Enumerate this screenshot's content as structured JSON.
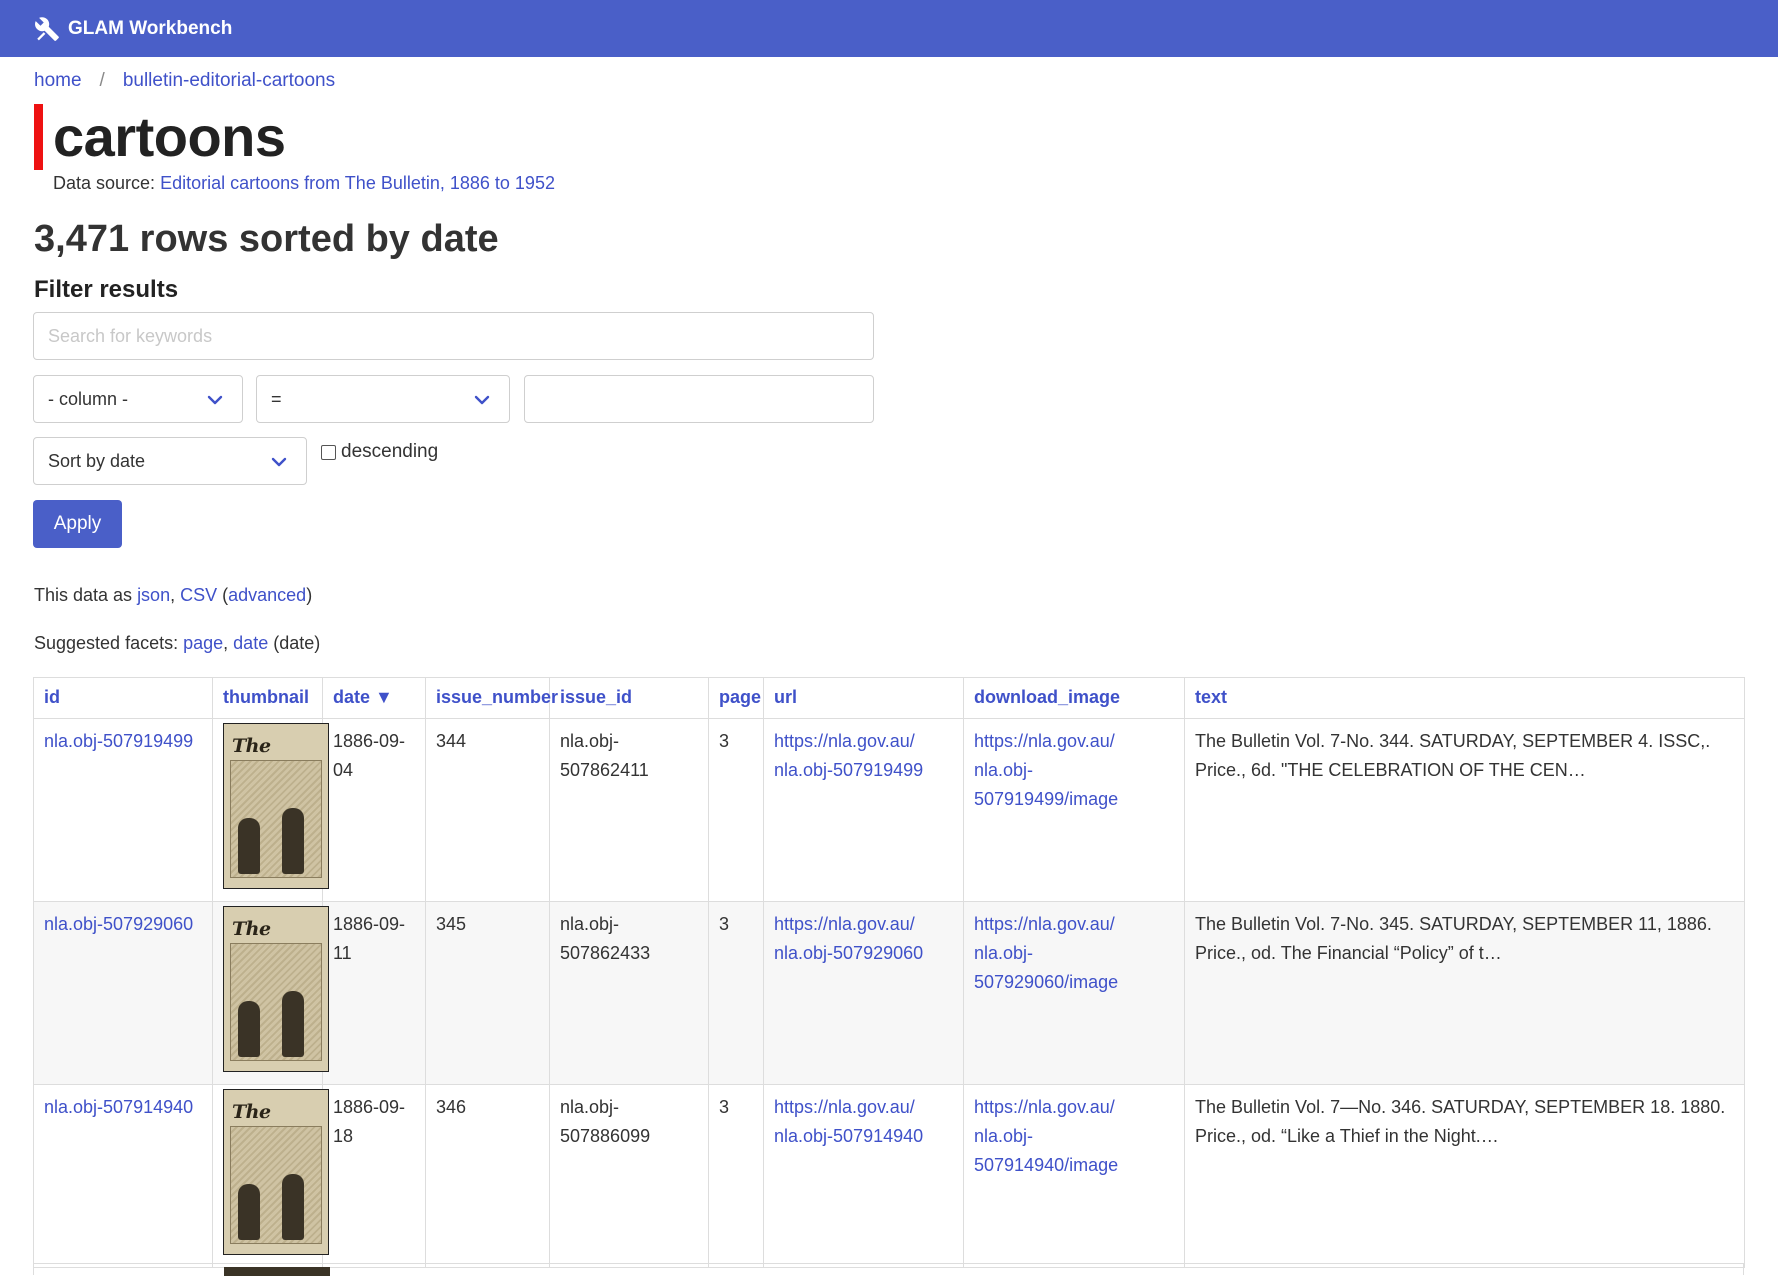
{
  "header": {
    "brand": "GLAM Workbench",
    "logo_icon": "tools-icon"
  },
  "breadcrumb": {
    "home": "home",
    "sep": "/",
    "database": "bulletin-editorial-cartoons"
  },
  "page": {
    "title": "cartoons",
    "source_prefix": "Data source: ",
    "source_link": "Editorial cartoons from The Bulletin, 1886 to 1952",
    "row_count": "3,471 rows sorted by date"
  },
  "filter": {
    "heading": "Filter results",
    "search_placeholder": "Search for keywords",
    "column_selected": "- column -",
    "operator_selected": "=",
    "sort_selected": "Sort by date",
    "descending_label": "descending",
    "apply_label": "Apply"
  },
  "export": {
    "prefix": "This data as ",
    "json": "json",
    "comma": ", ",
    "csv": "CSV",
    "open": " (",
    "advanced": "advanced",
    "close": ")"
  },
  "facets": {
    "prefix": "Suggested facets: ",
    "page": "page",
    "comma": ", ",
    "date": "date",
    "suffix": " (date)"
  },
  "table": {
    "columns": [
      "id",
      "thumbnail",
      "date ▼",
      "issue_number",
      "issue_id",
      "page",
      "url",
      "download_image",
      "text"
    ],
    "rows": [
      {
        "id": "nla.obj-507919499",
        "date": "1886-09-04",
        "issue_number": "344",
        "issue_id": "nla.obj-507862411",
        "page": "3",
        "url_1": "https://nla.gov.au/",
        "url_2": "nla.obj-507919499",
        "dl_1": "https://nla.gov.au/",
        "dl_2": "nla.obj-507919499/image",
        "text": "The Bulletin Vol. 7-No. 344. SATURDAY, SEPTEMBER 4. ISSC,. Price., 6d. \"THE CELEBRATION OF THE CEN…"
      },
      {
        "id": "nla.obj-507929060",
        "date": "1886-09-11",
        "issue_number": "345",
        "issue_id": "nla.obj-507862433",
        "page": "3",
        "url_1": "https://nla.gov.au/",
        "url_2": "nla.obj-507929060",
        "dl_1": "https://nla.gov.au/",
        "dl_2": "nla.obj-507929060/image",
        "text": "The Bulletin Vol. 7-No. 345. SATURDAY, SEPTEMBER 11, 1886. Price., od. The Financial “Policy” of t…"
      },
      {
        "id": "nla.obj-507914940",
        "date": "1886-09-18",
        "issue_number": "346",
        "issue_id": "nla.obj-507886099",
        "page": "3",
        "url_1": "https://nla.gov.au/",
        "url_2": "nla.obj-507914940",
        "dl_1": "https://nla.gov.au/",
        "dl_2": "nla.obj-507914940/image",
        "text": "The Bulletin Vol. 7—No. 346. SATURDAY, SEPTEMBER 18. 1880. Price., od. “Like a Thief in the Night.…"
      }
    ],
    "thumbnail_masthead": "The Bulletin"
  },
  "colors": {
    "accent": "#4a5fc8",
    "link": "#3f51c9",
    "title_bar": "#ee1111"
  }
}
